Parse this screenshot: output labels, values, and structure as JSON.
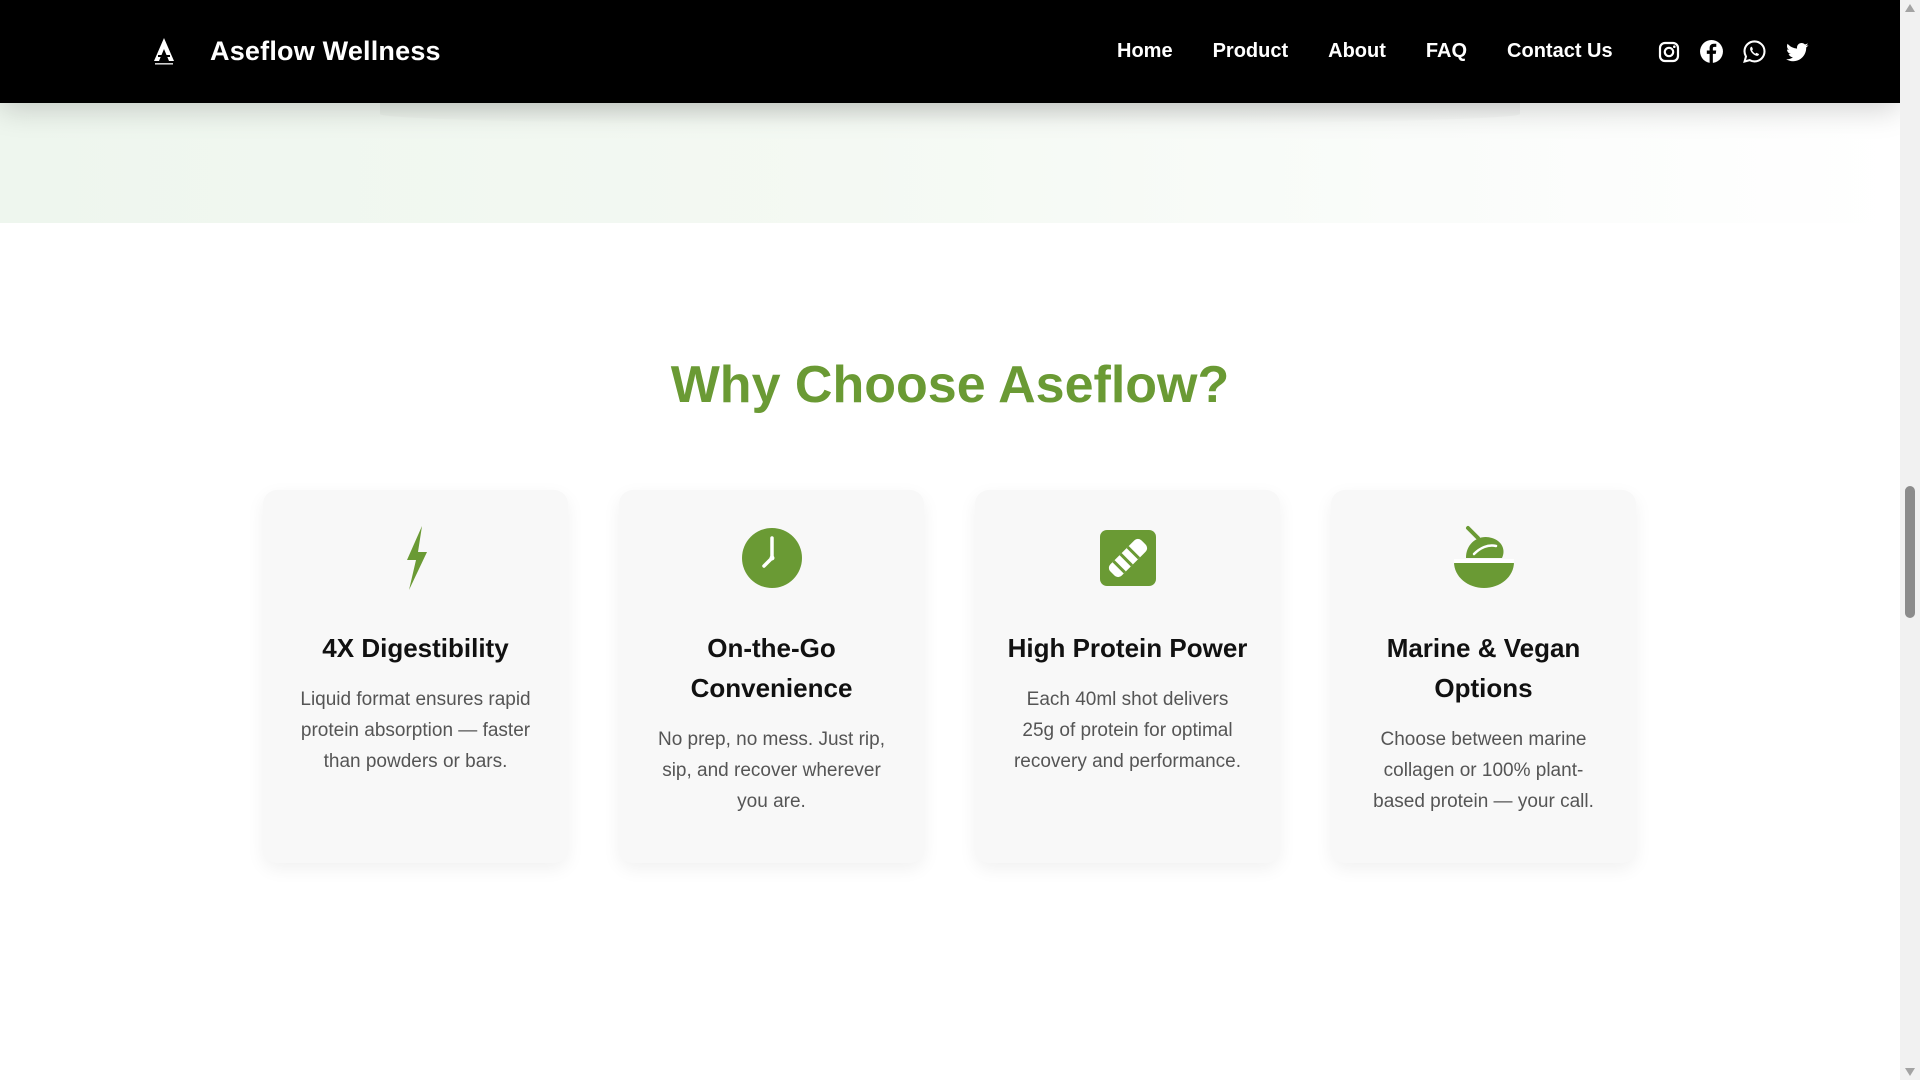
{
  "header": {
    "brand_name": "Aseflow Wellness",
    "nav": [
      "Home",
      "Product",
      "About",
      "FAQ",
      "Contact Us"
    ],
    "social": [
      "instagram-icon",
      "facebook-icon",
      "whatsapp-icon",
      "twitter-icon"
    ]
  },
  "section": {
    "title": "Why Choose Aseflow?",
    "cards": [
      {
        "icon": "lightning-bolt-icon",
        "title": "4X Digestibility",
        "text": "Liquid format ensures rapid protein absorption — faster than powders or bars."
      },
      {
        "icon": "clock-icon",
        "title": "On-the-Go Convenience",
        "text": "No prep, no mess. Just rip, sip, and recover wherever you are."
      },
      {
        "icon": "protein-bar-icon",
        "title": "High Protein Power",
        "text": "Each 40ml shot delivers 25g of protein for optimal recovery and performance."
      },
      {
        "icon": "leaf-bowl-icon",
        "title": "Marine & Vegan Options",
        "text": "Choose between marine collagen or 100% plant-based protein — your call."
      }
    ]
  },
  "colors": {
    "accent": "#6a9a34",
    "header_bg": "#000000",
    "card_bg": "#f8f8f8"
  }
}
